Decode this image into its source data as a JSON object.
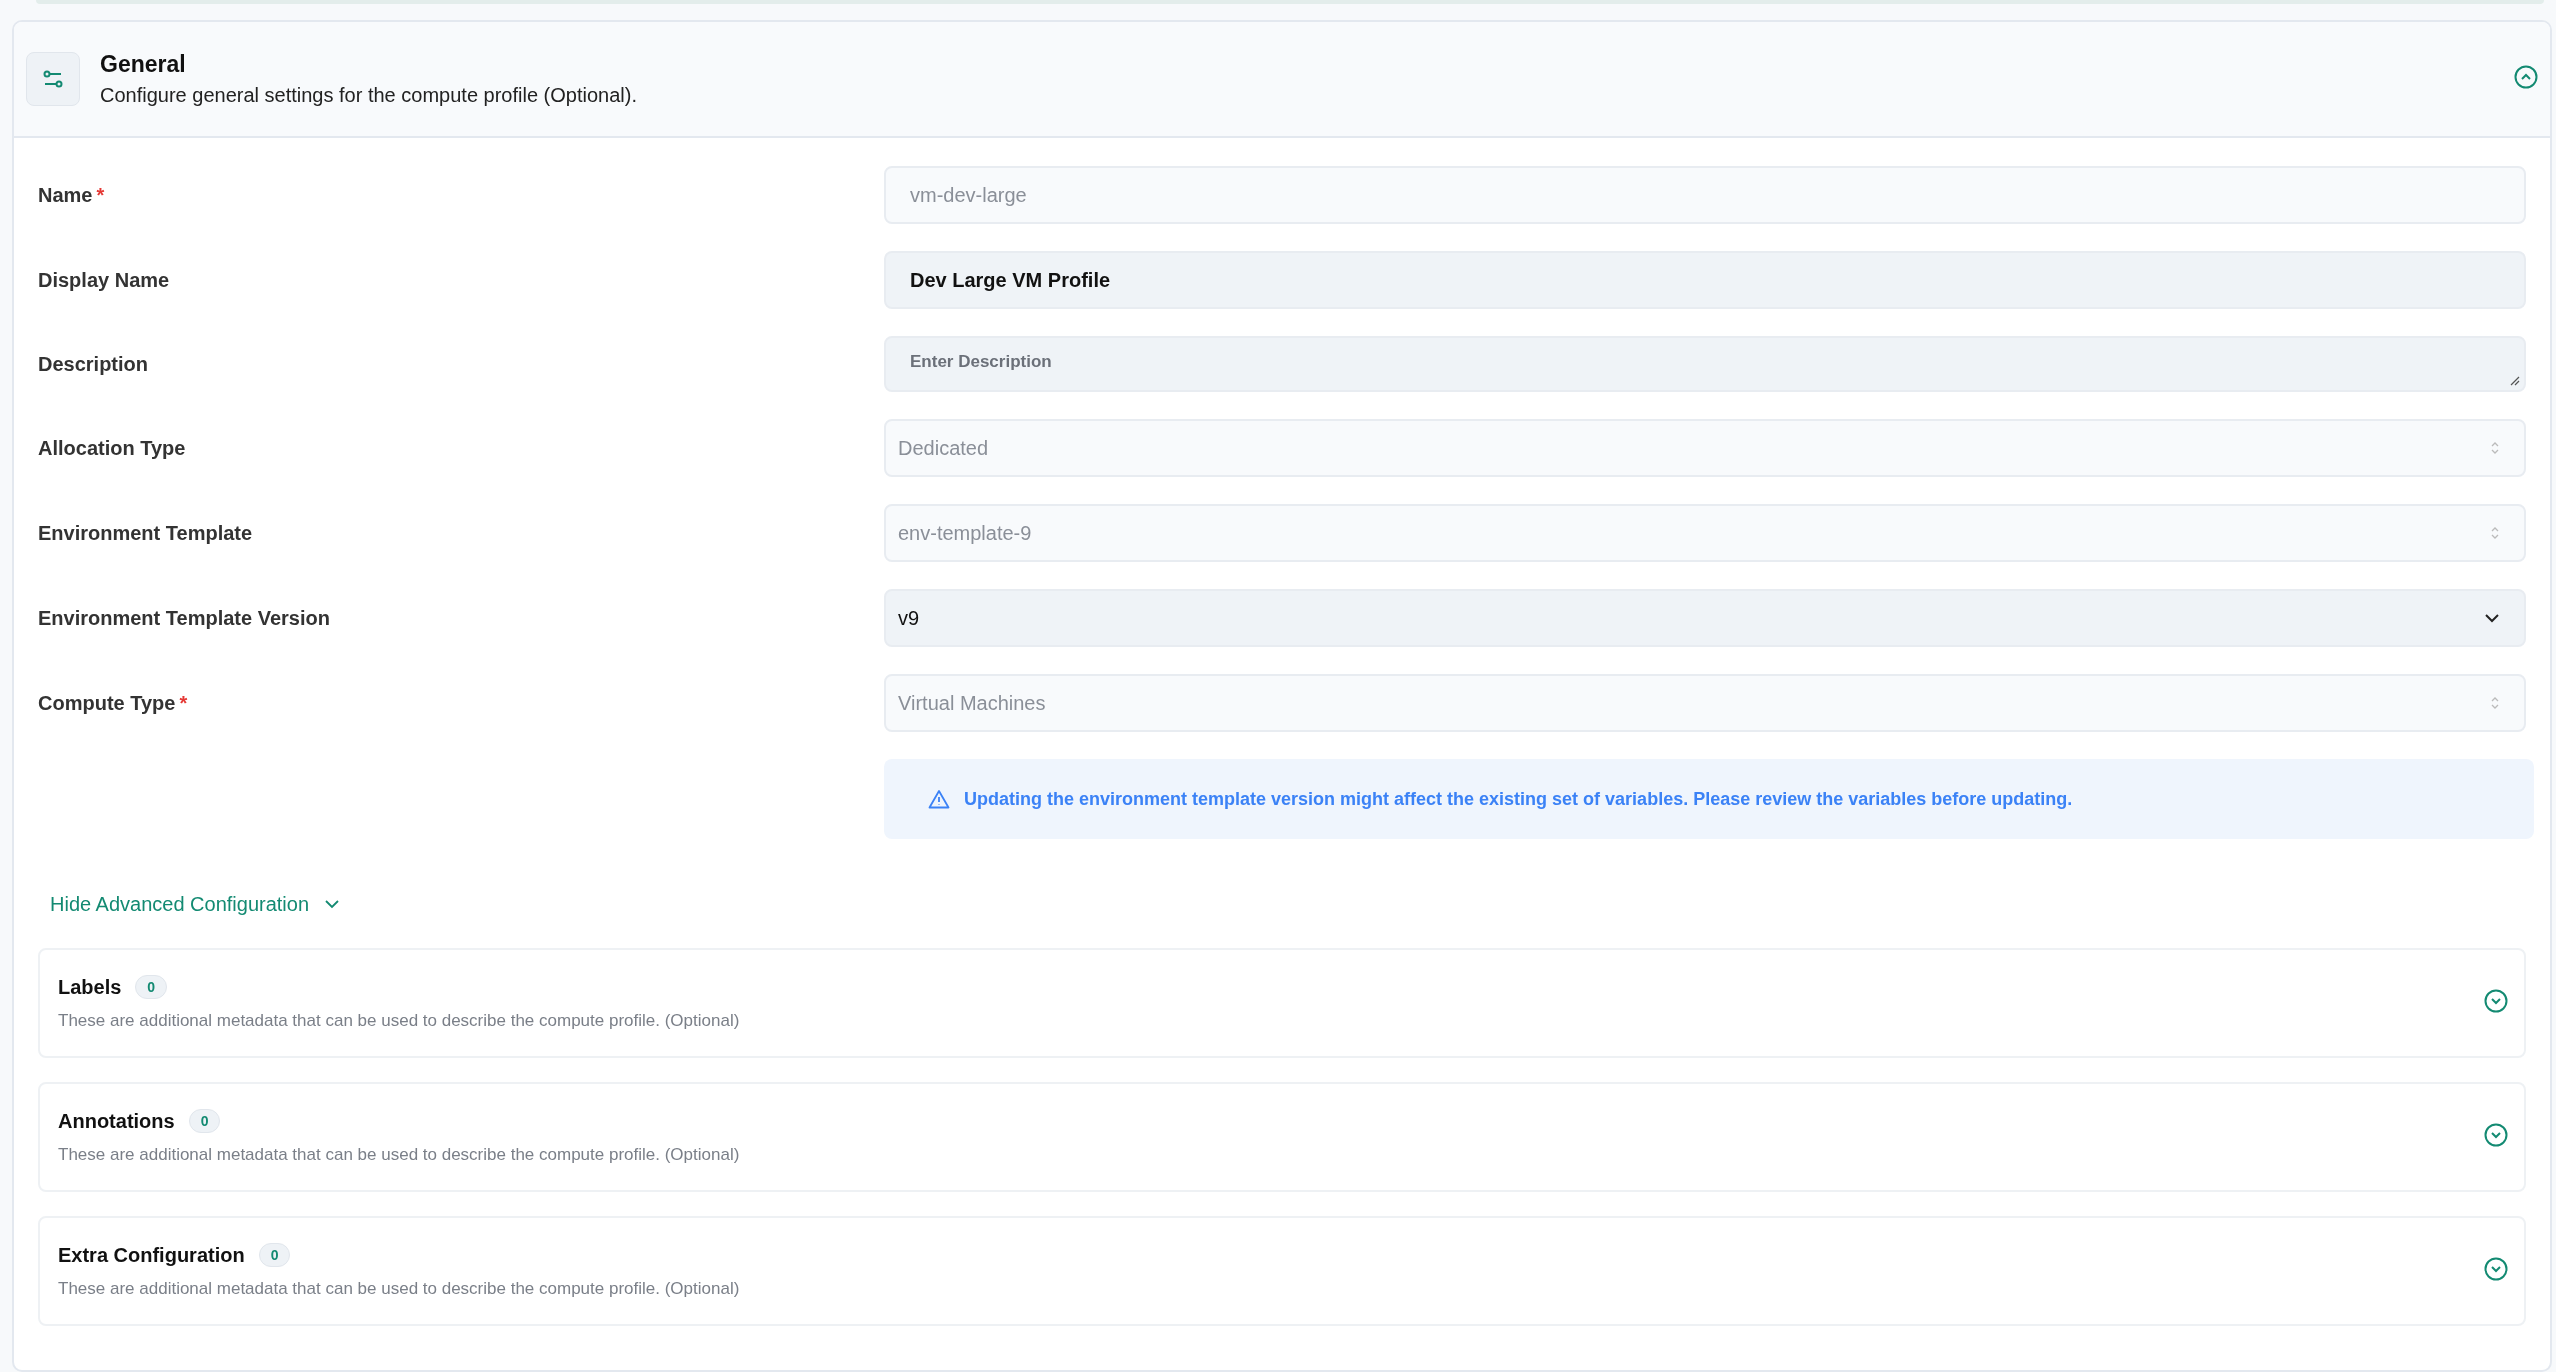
{
  "section": {
    "title": "General",
    "subtitle": "Configure general settings for the compute profile (Optional).",
    "expanded": true
  },
  "fields": [
    {
      "label": "Name",
      "required": true,
      "kind": "text",
      "disabled": true,
      "value": "vm-dev-large"
    },
    {
      "label": "Display Name",
      "required": false,
      "kind": "text",
      "disabled": false,
      "value": "Dev Large VM Profile"
    },
    {
      "label": "Description",
      "required": false,
      "kind": "textarea",
      "disabled": false,
      "placeholder": "Enter Description"
    },
    {
      "label": "Allocation Type",
      "required": false,
      "kind": "select",
      "disabled": true,
      "value": "Dedicated"
    },
    {
      "label": "Environment Template",
      "required": false,
      "kind": "select",
      "disabled": true,
      "value": "env-template-9"
    },
    {
      "label": "Environment Template Version",
      "required": false,
      "kind": "select",
      "disabled": false,
      "value": "v9"
    },
    {
      "label": "Compute Type",
      "required": true,
      "kind": "select",
      "disabled": true,
      "value": "Virtual Machines"
    }
  ],
  "required_marker": "*",
  "alert": "Updating the environment template version might affect the existing set of variables. Please review the variables before updating.",
  "advanced_toggle": "Hide Advanced Configuration",
  "cards": [
    {
      "title": "Labels",
      "count": "0",
      "description": "These are additional metadata that can be used to describe the compute profile. (Optional)",
      "expanded": false
    },
    {
      "title": "Annotations",
      "count": "0",
      "description": "These are additional metadata that can be used to describe the compute profile. (Optional)",
      "expanded": false
    },
    {
      "title": "Extra Configuration",
      "count": "0",
      "description": "These are additional metadata that can be used to describe the compute profile. (Optional)",
      "expanded": false
    }
  ]
}
